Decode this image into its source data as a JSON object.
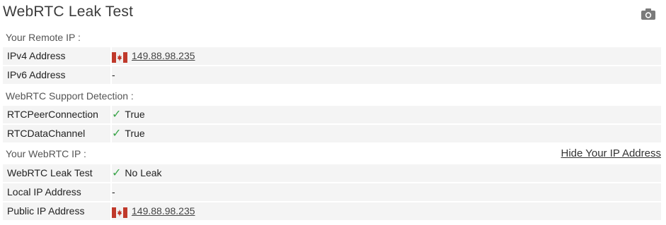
{
  "header": {
    "title": "WebRTC Leak Test",
    "screenshot_icon": "camera-icon"
  },
  "remote_ip": {
    "section_label": "Your Remote IP :",
    "rows": [
      {
        "key": "IPv4 Address",
        "value": "149.88.98.235",
        "flag": "canada-flag-icon"
      },
      {
        "key": "IPv6 Address",
        "value": "-"
      }
    ]
  },
  "support": {
    "section_label": "WebRTC Support Detection :",
    "rows": [
      {
        "key": "RTCPeerConnection",
        "value": "True",
        "check": "check-icon"
      },
      {
        "key": "RTCDataChannel",
        "value": "True",
        "check": "check-icon"
      }
    ]
  },
  "webrtc_ip": {
    "section_label": "Your WebRTC IP :",
    "hide_link": "Hide Your IP Address",
    "rows": [
      {
        "key": "WebRTC Leak Test",
        "value": "No Leak",
        "check": "check-icon"
      },
      {
        "key": "Local IP Address",
        "value": "-"
      },
      {
        "key": "Public IP Address",
        "value": "149.88.98.235",
        "flag": "canada-flag-icon"
      }
    ]
  },
  "colors": {
    "check": "#3aa54a",
    "row_bg": "#f4f4f4",
    "flag_red": "#c0392b"
  }
}
